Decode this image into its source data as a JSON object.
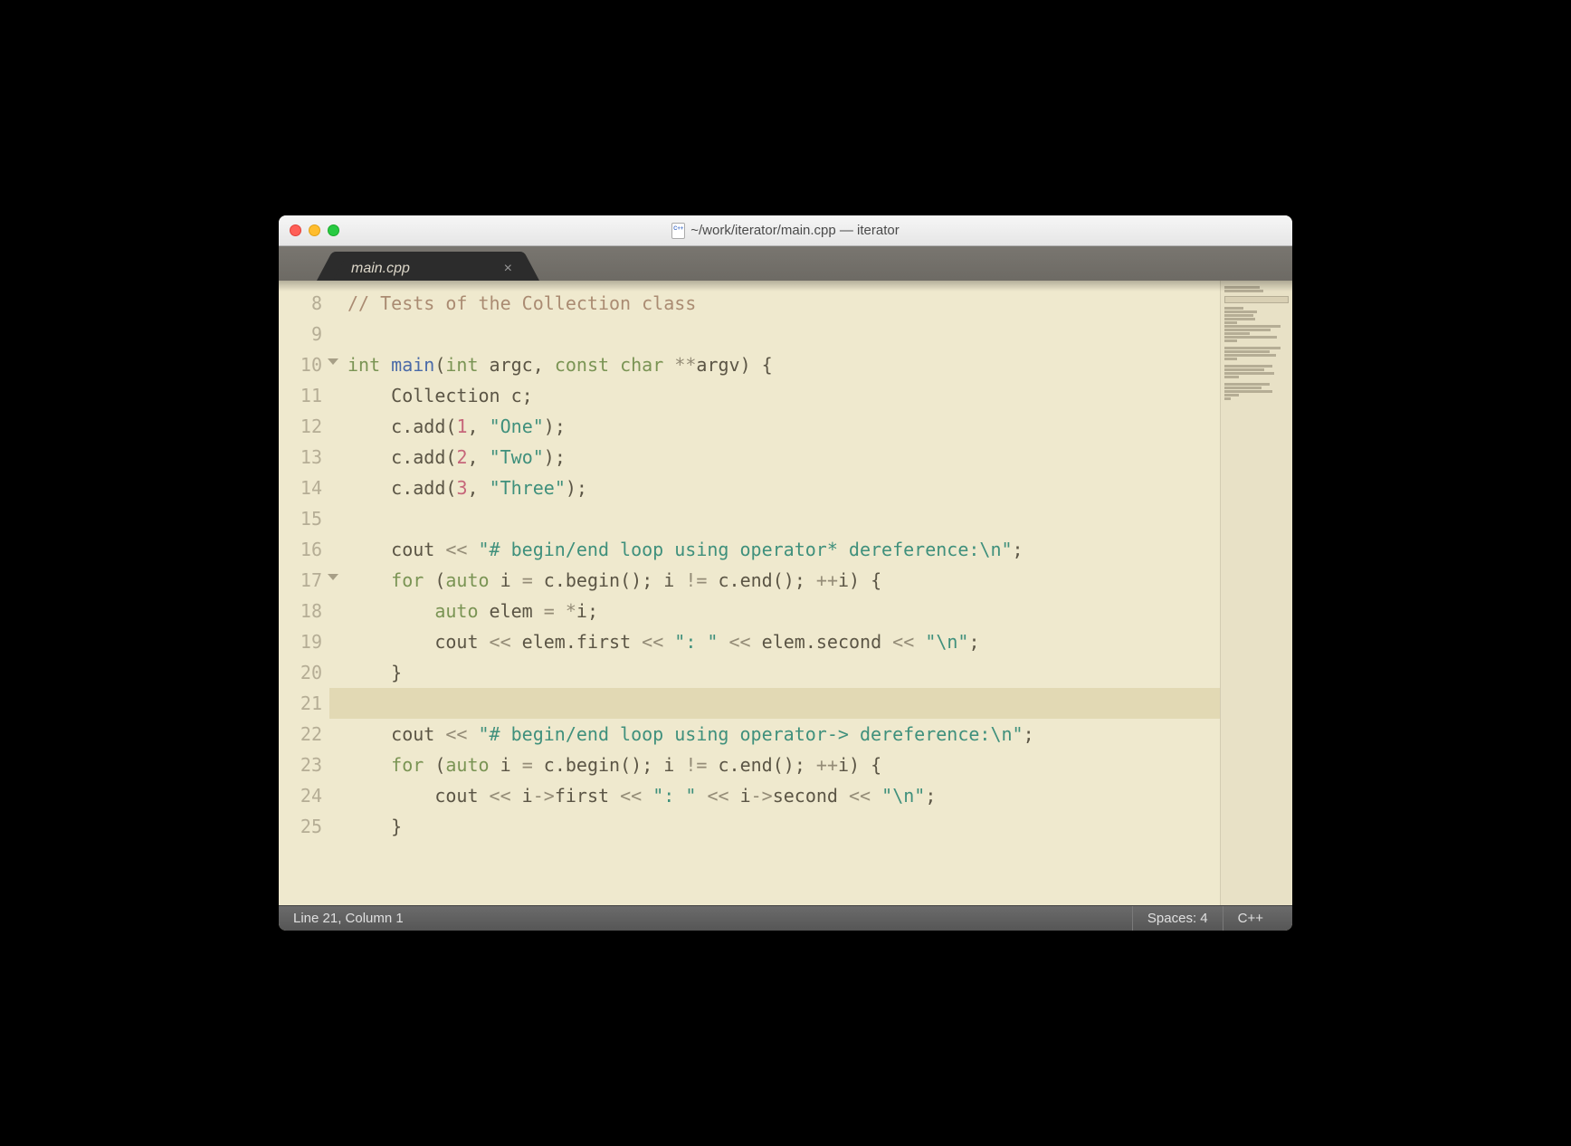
{
  "window": {
    "title": "~/work/iterator/main.cpp — iterator"
  },
  "tabs": [
    {
      "label": "main.cpp"
    }
  ],
  "statusbar": {
    "position": "Line 21, Column 1",
    "indent": "Spaces: 4",
    "syntax": "C++"
  },
  "editor": {
    "first_line": 8,
    "highlighted_line": 21,
    "fold_lines": [
      10,
      17
    ],
    "brace_indicator_line": 10,
    "lines": [
      {
        "n": 8,
        "tokens": [
          [
            "comment",
            "// Tests of the Collection class"
          ]
        ]
      },
      {
        "n": 9,
        "tokens": []
      },
      {
        "n": 10,
        "tokens": [
          [
            "type",
            "int"
          ],
          [
            "plain",
            " "
          ],
          [
            "func",
            "main"
          ],
          [
            "punc",
            "("
          ],
          [
            "type",
            "int"
          ],
          [
            "plain",
            " argc"
          ],
          [
            "punc",
            ","
          ],
          [
            "plain",
            " "
          ],
          [
            "keyword",
            "const"
          ],
          [
            "plain",
            " "
          ],
          [
            "type",
            "char"
          ],
          [
            "plain",
            " "
          ],
          [
            "op",
            "**"
          ],
          [
            "plain",
            "argv"
          ],
          [
            "punc",
            ")"
          ],
          [
            "plain",
            " "
          ],
          [
            "punc",
            "{"
          ]
        ]
      },
      {
        "n": 11,
        "tokens": [
          [
            "plain",
            "    Collection c"
          ],
          [
            "punc",
            ";"
          ]
        ]
      },
      {
        "n": 12,
        "tokens": [
          [
            "plain",
            "    c"
          ],
          [
            "punc",
            "."
          ],
          [
            "plain",
            "add"
          ],
          [
            "punc",
            "("
          ],
          [
            "number",
            "1"
          ],
          [
            "punc",
            ","
          ],
          [
            "plain",
            " "
          ],
          [
            "string",
            "\"One\""
          ],
          [
            "punc",
            ")"
          ],
          [
            "punc",
            ";"
          ]
        ]
      },
      {
        "n": 13,
        "tokens": [
          [
            "plain",
            "    c"
          ],
          [
            "punc",
            "."
          ],
          [
            "plain",
            "add"
          ],
          [
            "punc",
            "("
          ],
          [
            "number",
            "2"
          ],
          [
            "punc",
            ","
          ],
          [
            "plain",
            " "
          ],
          [
            "string",
            "\"Two\""
          ],
          [
            "punc",
            ")"
          ],
          [
            "punc",
            ";"
          ]
        ]
      },
      {
        "n": 14,
        "tokens": [
          [
            "plain",
            "    c"
          ],
          [
            "punc",
            "."
          ],
          [
            "plain",
            "add"
          ],
          [
            "punc",
            "("
          ],
          [
            "number",
            "3"
          ],
          [
            "punc",
            ","
          ],
          [
            "plain",
            " "
          ],
          [
            "string",
            "\"Three\""
          ],
          [
            "punc",
            ")"
          ],
          [
            "punc",
            ";"
          ]
        ]
      },
      {
        "n": 15,
        "tokens": []
      },
      {
        "n": 16,
        "tokens": [
          [
            "plain",
            "    cout "
          ],
          [
            "op",
            "<<"
          ],
          [
            "plain",
            " "
          ],
          [
            "string",
            "\"# begin/end loop using operator* dereference:\\n\""
          ],
          [
            "punc",
            ";"
          ]
        ]
      },
      {
        "n": 17,
        "tokens": [
          [
            "plain",
            "    "
          ],
          [
            "keyword",
            "for"
          ],
          [
            "plain",
            " "
          ],
          [
            "punc",
            "("
          ],
          [
            "keyword",
            "auto"
          ],
          [
            "plain",
            " i "
          ],
          [
            "op",
            "="
          ],
          [
            "plain",
            " c"
          ],
          [
            "punc",
            "."
          ],
          [
            "plain",
            "begin"
          ],
          [
            "punc",
            "()"
          ],
          [
            "punc",
            ";"
          ],
          [
            "plain",
            " i "
          ],
          [
            "op",
            "!="
          ],
          [
            "plain",
            " c"
          ],
          [
            "punc",
            "."
          ],
          [
            "plain",
            "end"
          ],
          [
            "punc",
            "()"
          ],
          [
            "punc",
            ";"
          ],
          [
            "plain",
            " "
          ],
          [
            "op",
            "++"
          ],
          [
            "plain",
            "i"
          ],
          [
            "punc",
            ")"
          ],
          [
            "plain",
            " "
          ],
          [
            "punc",
            "{"
          ]
        ]
      },
      {
        "n": 18,
        "tokens": [
          [
            "plain",
            "        "
          ],
          [
            "keyword",
            "auto"
          ],
          [
            "plain",
            " elem "
          ],
          [
            "op",
            "="
          ],
          [
            "plain",
            " "
          ],
          [
            "op",
            "*"
          ],
          [
            "plain",
            "i"
          ],
          [
            "punc",
            ";"
          ]
        ]
      },
      {
        "n": 19,
        "tokens": [
          [
            "plain",
            "        cout "
          ],
          [
            "op",
            "<<"
          ],
          [
            "plain",
            " elem"
          ],
          [
            "punc",
            "."
          ],
          [
            "plain",
            "first "
          ],
          [
            "op",
            "<<"
          ],
          [
            "plain",
            " "
          ],
          [
            "string",
            "\": \""
          ],
          [
            "plain",
            " "
          ],
          [
            "op",
            "<<"
          ],
          [
            "plain",
            " elem"
          ],
          [
            "punc",
            "."
          ],
          [
            "plain",
            "second "
          ],
          [
            "op",
            "<<"
          ],
          [
            "plain",
            " "
          ],
          [
            "string",
            "\"\\n\""
          ],
          [
            "punc",
            ";"
          ]
        ]
      },
      {
        "n": 20,
        "tokens": [
          [
            "plain",
            "    "
          ],
          [
            "punc",
            "}"
          ]
        ]
      },
      {
        "n": 21,
        "tokens": []
      },
      {
        "n": 22,
        "tokens": [
          [
            "plain",
            "    cout "
          ],
          [
            "op",
            "<<"
          ],
          [
            "plain",
            " "
          ],
          [
            "string",
            "\"# begin/end loop using operator-> dereference:\\n\""
          ],
          [
            "punc",
            ";"
          ]
        ]
      },
      {
        "n": 23,
        "tokens": [
          [
            "plain",
            "    "
          ],
          [
            "keyword",
            "for"
          ],
          [
            "plain",
            " "
          ],
          [
            "punc",
            "("
          ],
          [
            "keyword",
            "auto"
          ],
          [
            "plain",
            " i "
          ],
          [
            "op",
            "="
          ],
          [
            "plain",
            " c"
          ],
          [
            "punc",
            "."
          ],
          [
            "plain",
            "begin"
          ],
          [
            "punc",
            "()"
          ],
          [
            "punc",
            ";"
          ],
          [
            "plain",
            " i "
          ],
          [
            "op",
            "!="
          ],
          [
            "plain",
            " c"
          ],
          [
            "punc",
            "."
          ],
          [
            "plain",
            "end"
          ],
          [
            "punc",
            "()"
          ],
          [
            "punc",
            ";"
          ],
          [
            "plain",
            " "
          ],
          [
            "op",
            "++"
          ],
          [
            "plain",
            "i"
          ],
          [
            "punc",
            ")"
          ],
          [
            "plain",
            " "
          ],
          [
            "punc",
            "{"
          ]
        ]
      },
      {
        "n": 24,
        "tokens": [
          [
            "plain",
            "        cout "
          ],
          [
            "op",
            "<<"
          ],
          [
            "plain",
            " i"
          ],
          [
            "op",
            "->"
          ],
          [
            "plain",
            "first "
          ],
          [
            "op",
            "<<"
          ],
          [
            "plain",
            " "
          ],
          [
            "string",
            "\": \""
          ],
          [
            "plain",
            " "
          ],
          [
            "op",
            "<<"
          ],
          [
            "plain",
            " i"
          ],
          [
            "op",
            "->"
          ],
          [
            "plain",
            "second "
          ],
          [
            "op",
            "<<"
          ],
          [
            "plain",
            " "
          ],
          [
            "string",
            "\"\\n\""
          ],
          [
            "punc",
            ";"
          ]
        ]
      },
      {
        "n": 25,
        "tokens": [
          [
            "plain",
            "    "
          ],
          [
            "punc",
            "}"
          ]
        ]
      }
    ]
  }
}
